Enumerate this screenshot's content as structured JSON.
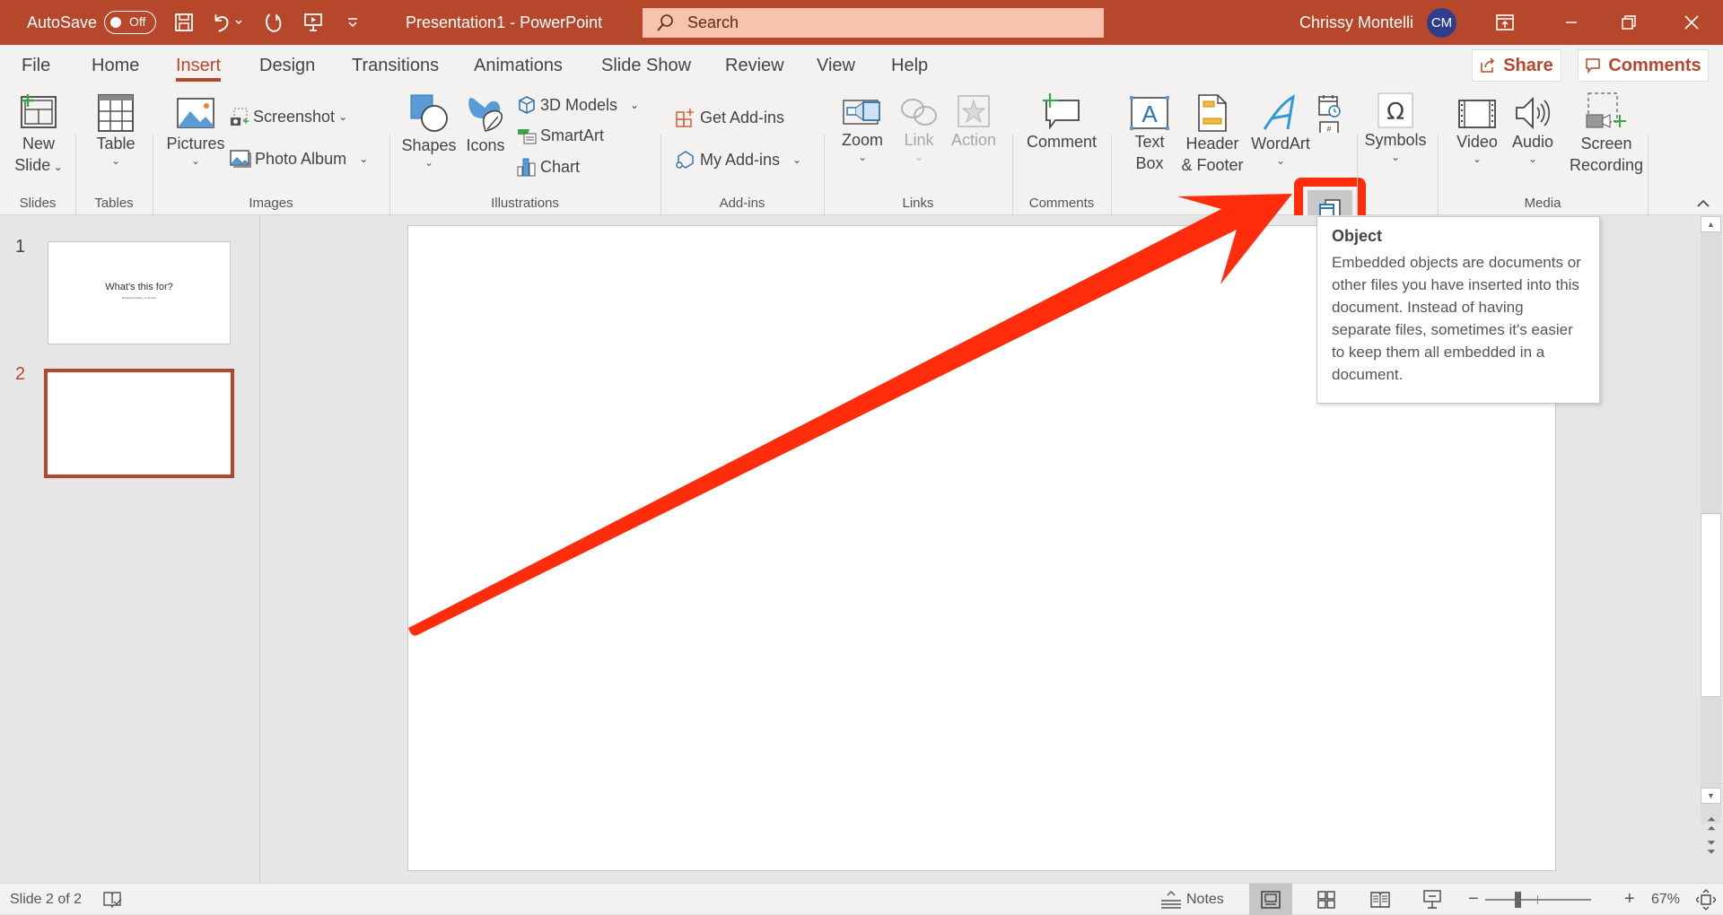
{
  "titlebar": {
    "autosave_label": "AutoSave",
    "autosave_state": "Off",
    "icons": [
      "save-icon",
      "undo-icon",
      "undo-dropdown-icon",
      "redo-icon",
      "present-from-start-icon",
      "customize-qat-icon"
    ],
    "document_title": "Presentation1  -  PowerPoint",
    "search_placeholder": "Search",
    "user_name": "Chrissy Montelli",
    "user_initials": "CM",
    "window_controls": [
      "ribbon-display-options-icon",
      "minimize-icon",
      "restore-icon",
      "close-icon"
    ]
  },
  "ribbon": {
    "tabs": [
      {
        "label": "File"
      },
      {
        "label": "Home"
      },
      {
        "label": "Insert",
        "active": true
      },
      {
        "label": "Design"
      },
      {
        "label": "Transitions"
      },
      {
        "label": "Animations"
      },
      {
        "label": "Slide Show"
      },
      {
        "label": "Review"
      },
      {
        "label": "View"
      },
      {
        "label": "Help"
      }
    ],
    "share_label": "Share",
    "comments_label": "Comments",
    "groups": {
      "slides": {
        "label": "Slides",
        "new_slide_line1": "New",
        "new_slide_line2": "Slide"
      },
      "tables": {
        "label": "Tables",
        "table": "Table"
      },
      "images": {
        "label": "Images",
        "pictures": "Pictures",
        "screenshot": "Screenshot",
        "photo_album": "Photo Album"
      },
      "illustrations": {
        "label": "Illustrations",
        "shapes": "Shapes",
        "icons": "Icons",
        "models_3d": "3D Models",
        "smartart": "SmartArt",
        "chart": "Chart"
      },
      "addins": {
        "label": "Add-ins",
        "get_addins": "Get Add-ins",
        "my_addins": "My Add-ins"
      },
      "links": {
        "label": "Links",
        "zoom": "Zoom",
        "link": "Link",
        "action": "Action"
      },
      "comments": {
        "label": "Comments",
        "comment": "Comment"
      },
      "text": {
        "text_box_line1": "Text",
        "text_box_line2": "Box",
        "header_footer_line1": "Header",
        "header_footer_line2": "& Footer",
        "wordart": "WordArt"
      },
      "symbols": {
        "symbols": "Symbols"
      },
      "media": {
        "label": "Media",
        "video": "Video",
        "audio": "Audio",
        "screen_recording_line1": "Screen",
        "screen_recording_line2": "Recording"
      }
    }
  },
  "tooltip": {
    "title": "Object",
    "body": "Embedded objects are documents or other files you have inserted into this document. Instead of having separate files, sometimes it's easier to keep them all embedded in a document."
  },
  "thumbnails": [
    {
      "number": "1",
      "title": "What's this for?",
      "subtitle": "Business (inside), of course!"
    },
    {
      "number": "2",
      "title": "",
      "subtitle": "",
      "active": true
    }
  ],
  "statusbar": {
    "slide_info": "Slide 2 of 2",
    "notes_label": "Notes",
    "zoom_percent": "67%",
    "zoom_slider_value": 67
  },
  "annotation": {
    "arrow_color": "#ff2d0b",
    "highlight_color": "#ff2d0b"
  },
  "colors": {
    "accent": "#b7472a",
    "search_bg": "#f8c3ac",
    "avatar_bg": "#2f3d8f"
  }
}
